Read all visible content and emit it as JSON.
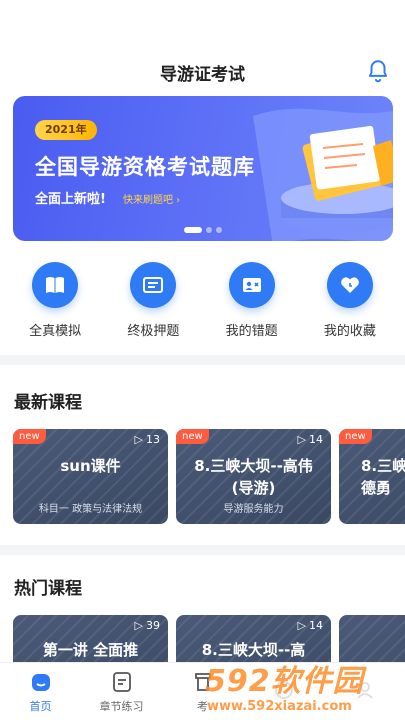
{
  "header": {
    "title": "导游证考试"
  },
  "banner": {
    "year": "2021年",
    "title": "全国导游资格考试题库",
    "subtitle": "全面上新啦!",
    "link": "快来刷题吧 ›"
  },
  "shortcuts": [
    {
      "label": "全真模拟",
      "icon": "book-icon"
    },
    {
      "label": "终极押题",
      "icon": "list-card-icon"
    },
    {
      "label": "我的错题",
      "icon": "wrong-card-icon"
    },
    {
      "label": "我的收藏",
      "icon": "heart-icon"
    }
  ],
  "latest": {
    "title": "最新课程",
    "courses": [
      {
        "badge": "new",
        "count": "13",
        "title": "sun课件",
        "sub": "科目一 政策与法律法规"
      },
      {
        "badge": "new",
        "count": "14",
        "title": "8.三峡大坝--高伟(导游)",
        "sub": "导游服务能力"
      },
      {
        "badge": "new",
        "count": "",
        "title": "8.三峡德勇",
        "sub": ""
      }
    ]
  },
  "hot": {
    "title": "热门课程",
    "courses": [
      {
        "count": "39",
        "title": "第一讲 全面推"
      },
      {
        "count": "14",
        "title": "8.三峡大坝--高"
      }
    ]
  },
  "tabbar": [
    {
      "label": "首页",
      "active": true
    },
    {
      "label": "章节练习",
      "active": false
    },
    {
      "label": "考",
      "active": false
    },
    {
      "label": "",
      "active": false
    },
    {
      "label": "",
      "active": false
    }
  ],
  "watermark": {
    "logo": "592软件园",
    "url": "www.592xiazai.com"
  },
  "colors": {
    "accent": "#2f7bf6",
    "badge": "#ff5b3f",
    "banner": "#5266f4"
  }
}
